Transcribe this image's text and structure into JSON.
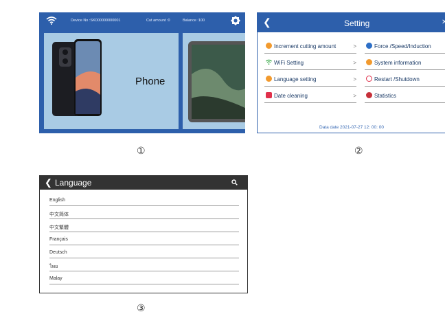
{
  "screen1": {
    "device_no": "Device No :SK000000000001",
    "cut_amount": "Cut amount :0",
    "balance": "Balance :100",
    "cards": [
      {
        "label": "Phone"
      },
      {
        "label": ""
      }
    ],
    "caption": "①"
  },
  "screen2": {
    "title": "Setting",
    "left_items": [
      {
        "label": "Increment cutting amount",
        "icon": "dollar-icon",
        "color": "#f29a2e"
      },
      {
        "label": "WiFi Setting",
        "icon": "wifi-icon",
        "color": "#35a845"
      },
      {
        "label": "Language setting",
        "icon": "globe-icon",
        "color": "#f29a2e"
      },
      {
        "label": "Date cleaning",
        "icon": "lock-icon",
        "color": "#e0304b"
      }
    ],
    "right_items": [
      {
        "label": "Force /Speed/Induction",
        "icon": "gauge-icon",
        "color": "#2d6fc7"
      },
      {
        "label": "System information",
        "icon": "gear-icon",
        "color": "#f29a2e"
      },
      {
        "label": "Restart /Shutdown",
        "icon": "power-icon",
        "color": "#e0304b"
      },
      {
        "label": "Statistics",
        "icon": "pie-icon",
        "color": "#c6303a"
      }
    ],
    "chevron": ">",
    "footer": "Data date 2021-07-27 12: 00: 00",
    "caption": "②"
  },
  "screen3": {
    "title": "Language",
    "languages": [
      "English",
      "中文简体",
      "中文繁體",
      "Français",
      "Deutsch",
      "ไทย",
      "Malay"
    ],
    "caption": "③"
  }
}
